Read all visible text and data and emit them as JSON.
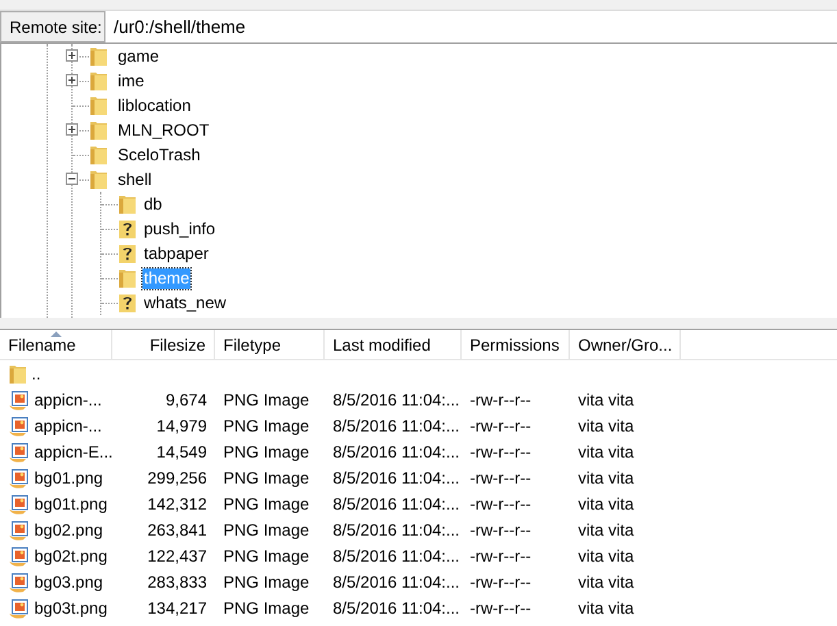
{
  "remote_site": {
    "label": "Remote site:",
    "path": "/ur0:/shell/theme"
  },
  "tree": [
    {
      "name": "game",
      "kind": "folder",
      "expanded": false,
      "selected": false
    },
    {
      "name": "ime",
      "kind": "folder",
      "expanded": false,
      "selected": false
    },
    {
      "name": "liblocation",
      "kind": "folder",
      "selected": false
    },
    {
      "name": "MLN_ROOT",
      "kind": "folder",
      "expanded": false,
      "selected": false
    },
    {
      "name": "SceloTrash",
      "kind": "folder",
      "selected": false
    },
    {
      "name": "shell",
      "kind": "folder",
      "expanded": true,
      "selected": false,
      "children": [
        {
          "name": "db",
          "kind": "folder",
          "selected": false
        },
        {
          "name": "push_info",
          "kind": "unknown",
          "selected": false
        },
        {
          "name": "tabpaper",
          "kind": "unknown",
          "selected": false
        },
        {
          "name": "theme",
          "kind": "folder",
          "selected": true
        },
        {
          "name": "whats_new",
          "kind": "unknown",
          "selected": false
        }
      ]
    }
  ],
  "file_list": {
    "columns": [
      {
        "label": "Filename",
        "sorted": true,
        "kind": "text"
      },
      {
        "label": "Filesize",
        "sorted": false,
        "kind": "number"
      },
      {
        "label": "Filetype",
        "sorted": false,
        "kind": "text"
      },
      {
        "label": "Last modified",
        "sorted": false,
        "kind": "text"
      },
      {
        "label": "Permissions",
        "sorted": false,
        "kind": "text"
      },
      {
        "label": "Owner/Gro...",
        "sorted": false,
        "kind": "text"
      }
    ],
    "rows": [
      {
        "kind": "folder",
        "cells": [
          ".."
        ]
      },
      {
        "kind": "image",
        "cells": [
          "appicn-...",
          "9,674",
          "PNG Image",
          "8/5/2016 11:04:...",
          "-rw-r--r--",
          "vita vita"
        ]
      },
      {
        "kind": "image",
        "cells": [
          "appicn-...",
          "14,979",
          "PNG Image",
          "8/5/2016 11:04:...",
          "-rw-r--r--",
          "vita vita"
        ]
      },
      {
        "kind": "image",
        "cells": [
          "appicn-E...",
          "14,549",
          "PNG Image",
          "8/5/2016 11:04:...",
          "-rw-r--r--",
          "vita vita"
        ]
      },
      {
        "kind": "image",
        "cells": [
          "bg01.png",
          "299,256",
          "PNG Image",
          "8/5/2016 11:04:...",
          "-rw-r--r--",
          "vita vita"
        ]
      },
      {
        "kind": "image",
        "cells": [
          "bg01t.png",
          "142,312",
          "PNG Image",
          "8/5/2016 11:04:...",
          "-rw-r--r--",
          "vita vita"
        ]
      },
      {
        "kind": "image",
        "cells": [
          "bg02.png",
          "263,841",
          "PNG Image",
          "8/5/2016 11:04:...",
          "-rw-r--r--",
          "vita vita"
        ]
      },
      {
        "kind": "image",
        "cells": [
          "bg02t.png",
          "122,437",
          "PNG Image",
          "8/5/2016 11:04:...",
          "-rw-r--r--",
          "vita vita"
        ]
      },
      {
        "kind": "image",
        "cells": [
          "bg03.png",
          "283,833",
          "PNG Image",
          "8/5/2016 11:04:...",
          "-rw-r--r--",
          "vita vita"
        ]
      },
      {
        "kind": "image",
        "cells": [
          "bg03t.png",
          "134,217",
          "PNG Image",
          "8/5/2016 11:04:...",
          "-rw-r--r--",
          "vita vita"
        ]
      }
    ]
  }
}
